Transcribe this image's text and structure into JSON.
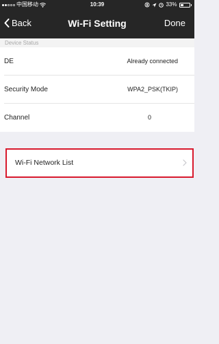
{
  "status_bar": {
    "carrier": "中国移动",
    "time": "10:39",
    "battery_percent": "33%",
    "battery_level": 0.33
  },
  "nav": {
    "back_label": "Back",
    "title": "Wi-Fi Setting",
    "done_label": "Done"
  },
  "device_status": {
    "section_title": "Device Status",
    "rows": [
      {
        "label": "DE",
        "value": "Already connected"
      },
      {
        "label": "Security Mode",
        "value": "WPA2_PSK(TKIP)"
      },
      {
        "label": "Channel",
        "value": "0"
      }
    ]
  },
  "network_list": {
    "label": "Wi-Fi Network List"
  },
  "colors": {
    "header_bg": "#262626",
    "page_bg": "#efeff4",
    "highlight_border": "#d8192c"
  }
}
